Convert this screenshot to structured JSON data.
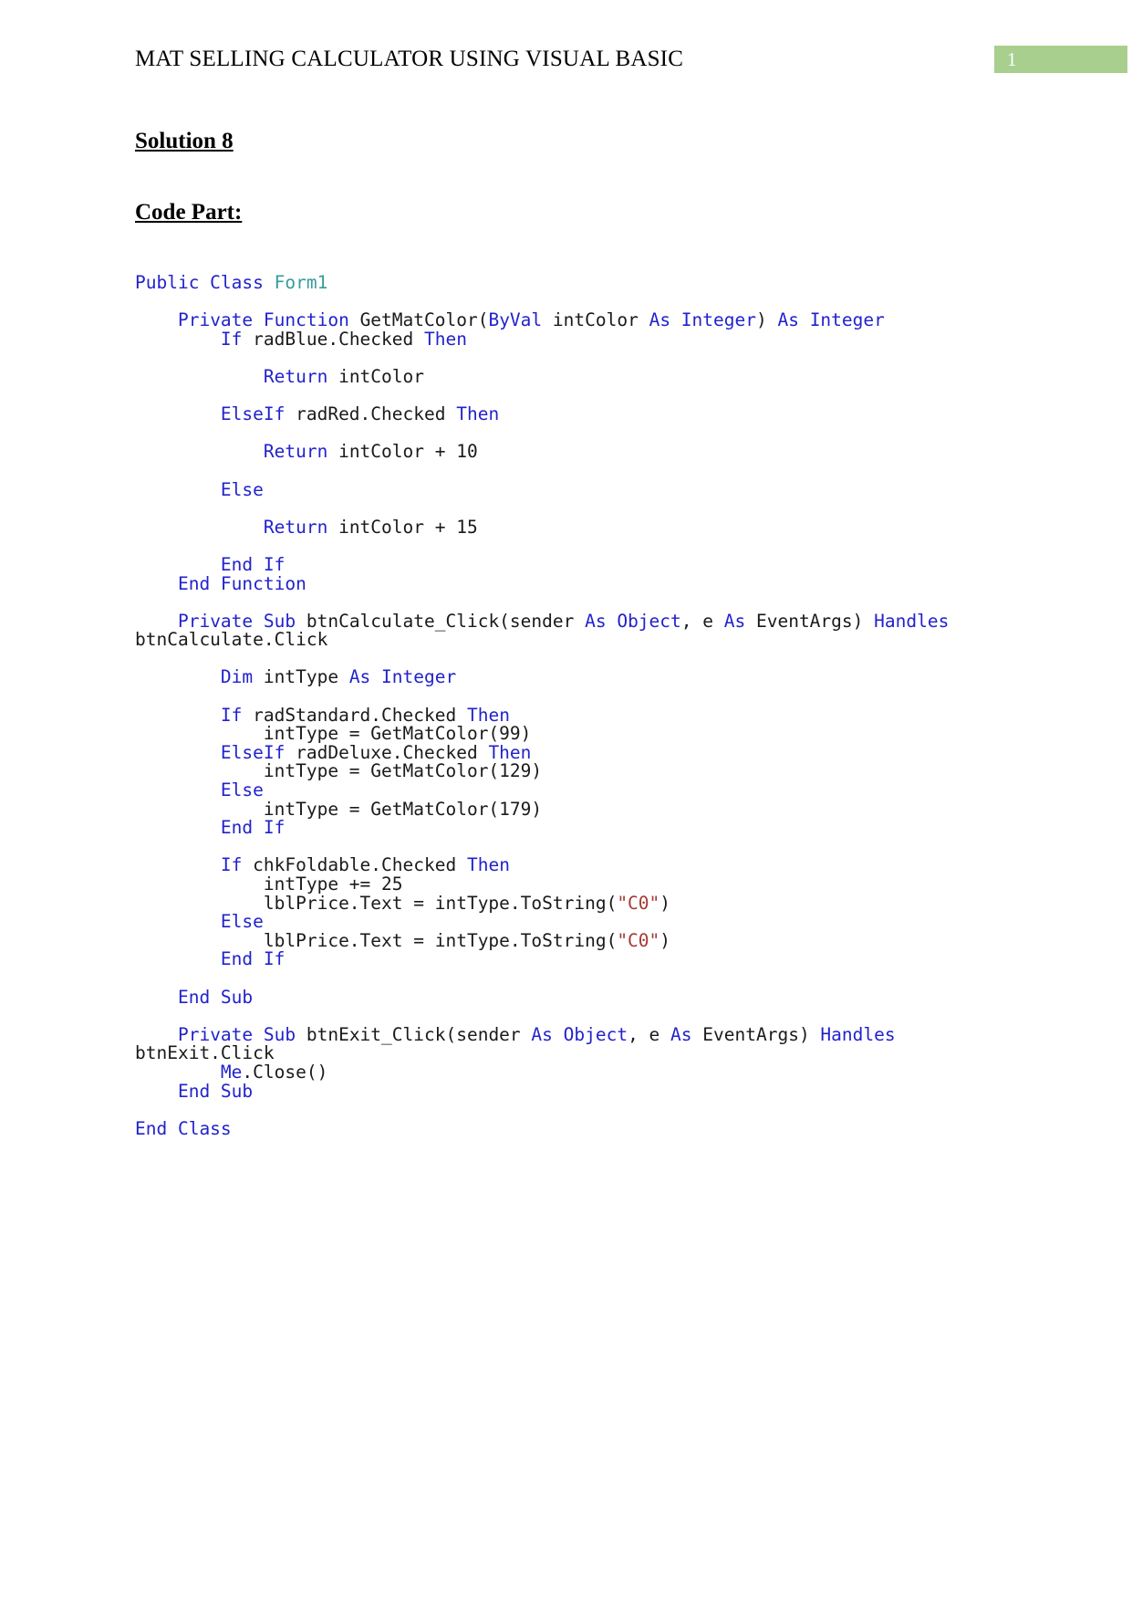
{
  "header": {
    "title": "MAT SELLING CALCULATOR USING VISUAL BASIC",
    "page_number": "1",
    "badge_color": "#a8cf8e"
  },
  "headings": {
    "solution": "Solution 8",
    "code_part": "Code Part:"
  },
  "colors": {
    "keyword": "#2222cc",
    "class_name": "#389a9a",
    "string": "#a33a33",
    "identifier": "#1a1a1a",
    "page_badge": "#a8cf8e"
  },
  "code": {
    "language": "Visual Basic .NET",
    "plain_text": "Public Class Form1\n\n    Private Function GetMatColor(ByVal intColor As Integer) As Integer\n        If radBlue.Checked Then\n\n            Return intColor\n\n        ElseIf radRed.Checked Then\n\n            Return intColor + 10\n\n        Else\n\n            Return intColor + 15\n\n        End If\n    End Function\n\n    Private Sub btnCalculate_Click(sender As Object, e As EventArgs) Handles btnCalculate.Click\n\n        Dim intType As Integer\n\n        If radStandard.Checked Then\n            intType = GetMatColor(99)\n        ElseIf radDeluxe.Checked Then\n            intType = GetMatColor(129)\n        Else\n            intType = GetMatColor(179)\n        End If\n\n        If chkFoldable.Checked Then\n            intType += 25\n            lblPrice.Text = intType.ToString(\"C0\")\n        Else\n            lblPrice.Text = intType.ToString(\"C0\")\n        End If\n\n    End Sub\n\n    Private Sub btnExit_Click(sender As Object, e As EventArgs) Handles btnExit.Click\n        Me.Close()\n    End Sub\n\nEnd Class",
    "lines": [
      {
        "id": "l1",
        "tokens": [
          {
            "t": "Public Class ",
            "c": "kw"
          },
          {
            "t": "Form1",
            "c": "cls"
          }
        ]
      },
      {
        "id": "l2",
        "tokens": []
      },
      {
        "id": "l3",
        "tokens": [
          {
            "t": "    ",
            "c": "plain"
          },
          {
            "t": "Private Function ",
            "c": "kw"
          },
          {
            "t": "GetMatColor(",
            "c": "id"
          },
          {
            "t": "ByVal ",
            "c": "kw"
          },
          {
            "t": "intColor ",
            "c": "id"
          },
          {
            "t": "As Integer",
            "c": "kw"
          },
          {
            "t": ")",
            "c": "id"
          },
          {
            "t": " As Integer",
            "c": "kw"
          }
        ]
      },
      {
        "id": "l4",
        "tokens": [
          {
            "t": "        ",
            "c": "plain"
          },
          {
            "t": "If ",
            "c": "kw"
          },
          {
            "t": "radBlue.Checked ",
            "c": "id"
          },
          {
            "t": "Then",
            "c": "kw"
          }
        ]
      },
      {
        "id": "l5",
        "tokens": []
      },
      {
        "id": "l6",
        "tokens": [
          {
            "t": "            ",
            "c": "plain"
          },
          {
            "t": "Return ",
            "c": "kw"
          },
          {
            "t": "intColor",
            "c": "id"
          }
        ]
      },
      {
        "id": "l7",
        "tokens": []
      },
      {
        "id": "l8",
        "tokens": [
          {
            "t": "        ",
            "c": "plain"
          },
          {
            "t": "ElseIf ",
            "c": "kw"
          },
          {
            "t": "radRed.Checked ",
            "c": "id"
          },
          {
            "t": "Then",
            "c": "kw"
          }
        ]
      },
      {
        "id": "l9",
        "tokens": []
      },
      {
        "id": "l10",
        "tokens": [
          {
            "t": "            ",
            "c": "plain"
          },
          {
            "t": "Return ",
            "c": "kw"
          },
          {
            "t": "intColor + 10",
            "c": "id"
          }
        ]
      },
      {
        "id": "l11",
        "tokens": []
      },
      {
        "id": "l12",
        "tokens": [
          {
            "t": "        ",
            "c": "plain"
          },
          {
            "t": "Else",
            "c": "kw"
          }
        ]
      },
      {
        "id": "l13",
        "tokens": []
      },
      {
        "id": "l14",
        "tokens": [
          {
            "t": "            ",
            "c": "plain"
          },
          {
            "t": "Return ",
            "c": "kw"
          },
          {
            "t": "intColor + 15",
            "c": "id"
          }
        ]
      },
      {
        "id": "l15",
        "tokens": []
      },
      {
        "id": "l16",
        "tokens": [
          {
            "t": "        ",
            "c": "plain"
          },
          {
            "t": "End If",
            "c": "kw"
          }
        ]
      },
      {
        "id": "l17",
        "tokens": [
          {
            "t": "    ",
            "c": "plain"
          },
          {
            "t": "End Function",
            "c": "kw"
          }
        ]
      },
      {
        "id": "l18",
        "tokens": []
      },
      {
        "id": "l19",
        "tokens": [
          {
            "t": "    ",
            "c": "plain"
          },
          {
            "t": "Private Sub ",
            "c": "kw"
          },
          {
            "t": "btnCalculate_Click(sender ",
            "c": "id"
          },
          {
            "t": "As Object",
            "c": "kw"
          },
          {
            "t": ", e ",
            "c": "id"
          },
          {
            "t": "As ",
            "c": "kw"
          },
          {
            "t": "EventArgs) ",
            "c": "id"
          },
          {
            "t": "Handles ",
            "c": "kw"
          },
          {
            "t": "btnCalculate.Click",
            "c": "id"
          }
        ]
      },
      {
        "id": "l20",
        "tokens": []
      },
      {
        "id": "l21",
        "tokens": [
          {
            "t": "        ",
            "c": "plain"
          },
          {
            "t": "Dim ",
            "c": "kw"
          },
          {
            "t": "intType ",
            "c": "id"
          },
          {
            "t": "As Integer",
            "c": "kw"
          }
        ]
      },
      {
        "id": "l22",
        "tokens": []
      },
      {
        "id": "l23",
        "tokens": [
          {
            "t": "        ",
            "c": "plain"
          },
          {
            "t": "If ",
            "c": "kw"
          },
          {
            "t": "radStandard.Checked ",
            "c": "id"
          },
          {
            "t": "Then",
            "c": "kw"
          }
        ]
      },
      {
        "id": "l24",
        "tokens": [
          {
            "t": "            intType = GetMatColor(99)",
            "c": "id"
          }
        ]
      },
      {
        "id": "l25",
        "tokens": [
          {
            "t": "        ",
            "c": "plain"
          },
          {
            "t": "ElseIf ",
            "c": "kw"
          },
          {
            "t": "radDeluxe.Checked ",
            "c": "id"
          },
          {
            "t": "Then",
            "c": "kw"
          }
        ]
      },
      {
        "id": "l26",
        "tokens": [
          {
            "t": "            intType = GetMatColor(129)",
            "c": "id"
          }
        ]
      },
      {
        "id": "l27",
        "tokens": [
          {
            "t": "        ",
            "c": "plain"
          },
          {
            "t": "Else",
            "c": "kw"
          }
        ]
      },
      {
        "id": "l28",
        "tokens": [
          {
            "t": "            intType = GetMatColor(179)",
            "c": "id"
          }
        ]
      },
      {
        "id": "l29",
        "tokens": [
          {
            "t": "        ",
            "c": "plain"
          },
          {
            "t": "End If",
            "c": "kw"
          }
        ]
      },
      {
        "id": "l30",
        "tokens": []
      },
      {
        "id": "l31",
        "tokens": [
          {
            "t": "        ",
            "c": "plain"
          },
          {
            "t": "If ",
            "c": "kw"
          },
          {
            "t": "chkFoldable.Checked ",
            "c": "id"
          },
          {
            "t": "Then",
            "c": "kw"
          }
        ]
      },
      {
        "id": "l32",
        "tokens": [
          {
            "t": "            intType += 25",
            "c": "id"
          }
        ]
      },
      {
        "id": "l33",
        "tokens": [
          {
            "t": "            lblPrice.Text = intType.ToString(",
            "c": "id"
          },
          {
            "t": "\"C0\"",
            "c": "str"
          },
          {
            "t": ")",
            "c": "id"
          }
        ]
      },
      {
        "id": "l34",
        "tokens": [
          {
            "t": "        ",
            "c": "plain"
          },
          {
            "t": "Else",
            "c": "kw"
          }
        ]
      },
      {
        "id": "l35",
        "tokens": [
          {
            "t": "            lblPrice.Text = intType.ToString(",
            "c": "id"
          },
          {
            "t": "\"C0\"",
            "c": "str"
          },
          {
            "t": ")",
            "c": "id"
          }
        ]
      },
      {
        "id": "l36",
        "tokens": [
          {
            "t": "        ",
            "c": "plain"
          },
          {
            "t": "End If",
            "c": "kw"
          }
        ]
      },
      {
        "id": "l37",
        "tokens": []
      },
      {
        "id": "l38",
        "tokens": [
          {
            "t": "    ",
            "c": "plain"
          },
          {
            "t": "End Sub",
            "c": "kw"
          }
        ]
      },
      {
        "id": "l39",
        "tokens": []
      },
      {
        "id": "l40",
        "tokens": [
          {
            "t": "    ",
            "c": "plain"
          },
          {
            "t": "Private Sub ",
            "c": "kw"
          },
          {
            "t": "btnExit_Click(sender ",
            "c": "id"
          },
          {
            "t": "As Object",
            "c": "kw"
          },
          {
            "t": ", e ",
            "c": "id"
          },
          {
            "t": "As ",
            "c": "kw"
          },
          {
            "t": "EventArgs) ",
            "c": "id"
          },
          {
            "t": "Handles ",
            "c": "kw"
          },
          {
            "t": "btnExit.Click",
            "c": "id"
          }
        ]
      },
      {
        "id": "l41",
        "tokens": [
          {
            "t": "        ",
            "c": "plain"
          },
          {
            "t": "Me",
            "c": "kw"
          },
          {
            "t": ".Close()",
            "c": "id"
          }
        ]
      },
      {
        "id": "l42",
        "tokens": [
          {
            "t": "    ",
            "c": "plain"
          },
          {
            "t": "End Sub",
            "c": "kw"
          }
        ]
      },
      {
        "id": "l43",
        "tokens": []
      },
      {
        "id": "l44",
        "tokens": [
          {
            "t": "End Class",
            "c": "kw"
          }
        ]
      }
    ]
  }
}
